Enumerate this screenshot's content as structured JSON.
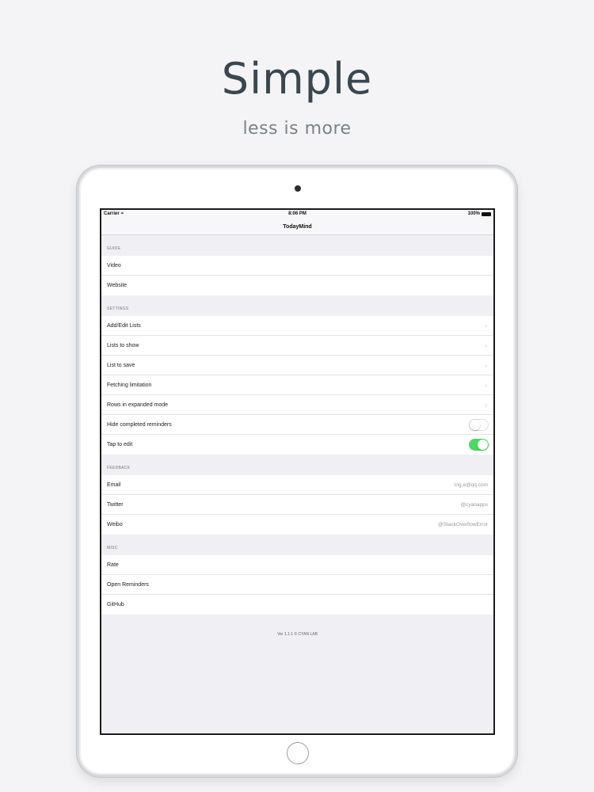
{
  "promo": {
    "headline": "Simple",
    "subline": "less is more"
  },
  "status_bar": {
    "carrier": "Carrier",
    "time": "8:06 PM",
    "battery": "100%"
  },
  "nav": {
    "title": "TodayMind"
  },
  "sections": {
    "guide": {
      "header": "GUIDE",
      "rows": [
        "Video",
        "Website"
      ]
    },
    "settings": {
      "header": "SETTINGS",
      "rows": [
        "Add/Edit Lists",
        "Lists to show",
        "List to save",
        "Fetching limitation",
        "Rows in expanded mode"
      ],
      "toggles": [
        {
          "label": "Hide completed reminders",
          "on": false
        },
        {
          "label": "Tap to edit",
          "on": true
        }
      ]
    },
    "feedback": {
      "header": "FEEDBACK",
      "rows": [
        {
          "label": "Email",
          "value": "log.e@qq.com"
        },
        {
          "label": "Twitter",
          "value": "@cyanapps"
        },
        {
          "label": "Weibo",
          "value": "@StackOverflowError"
        }
      ]
    },
    "misc": {
      "header": "MISC",
      "rows": [
        "Rate",
        "Open Reminders",
        "GitHub"
      ]
    }
  },
  "footer": "Ver 1.1.1 © CYAN LAB",
  "colors": {
    "toggle_on": "#4cd964",
    "background": "#f0f0f4",
    "headline": "#3a474f"
  }
}
